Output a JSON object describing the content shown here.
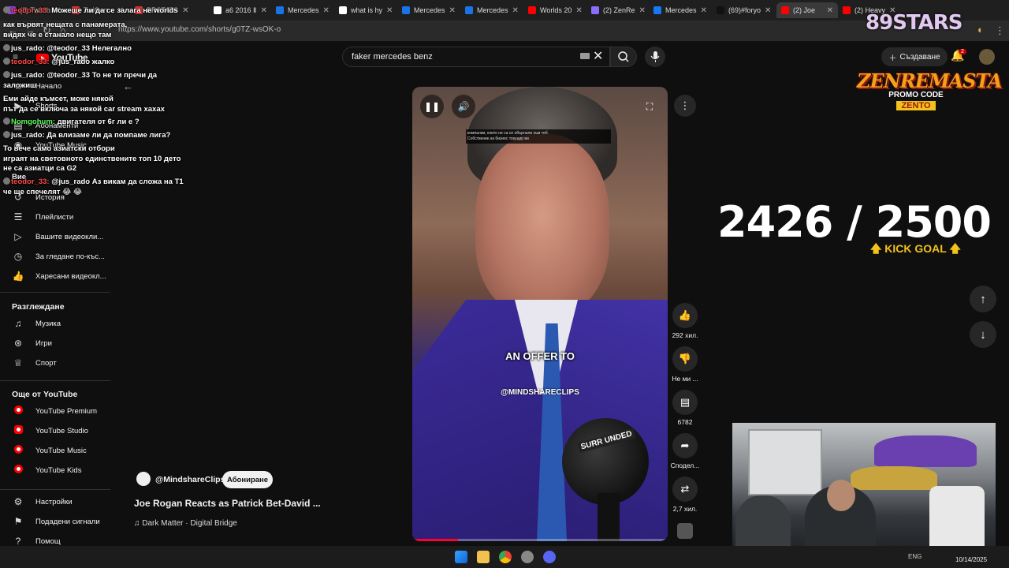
{
  "browser": {
    "url": "https://www.youtube.com/shorts/g0TZ-wsOK-o",
    "tabs": [
      {
        "label": "(2) Twitch",
        "color": "#9147ff"
      },
      {
        "label": "TwiGen",
        "color": "#e3342f"
      },
      {
        "label": "BRSTATS",
        "color": "#e3342f"
      },
      {
        "label": "a6 2016 Ⅱ",
        "color": "#ffffff"
      },
      {
        "label": "Mercedes",
        "color": "#1a73e8"
      },
      {
        "label": "what is hy",
        "color": "#ffffff"
      },
      {
        "label": "Mercedes",
        "color": "#1a73e8"
      },
      {
        "label": "Mercedes",
        "color": "#1a73e8"
      },
      {
        "label": "Worlds 20",
        "color": "#ff0000"
      },
      {
        "label": "(2) ZenRe",
        "color": "#8a6cff"
      },
      {
        "label": "Mercedes",
        "color": "#1877f2"
      },
      {
        "label": "(69)#foryo",
        "color": "#111111"
      },
      {
        "label": "(2) Joe",
        "color": "#ff0000"
      },
      {
        "label": "(2) Heavy",
        "color": "#ff0000"
      }
    ]
  },
  "masthead": {
    "search_value": "faker mercedes benz",
    "create_label": "Създаване",
    "notifications_count": "2",
    "logo_text": "YouTube"
  },
  "sidebar": {
    "top": [
      {
        "label": "Начало",
        "icon": "home-icon",
        "glyph": "⌂"
      },
      {
        "label": "Shorts",
        "icon": "shorts-icon",
        "glyph": "▶"
      },
      {
        "label": "Абонаменти",
        "icon": "subscriptions-icon",
        "glyph": "▤"
      },
      {
        "label": "YouTube Music",
        "icon": "music-icon",
        "glyph": "◉"
      }
    ],
    "you_label": "Вие",
    "you": [
      {
        "label": "История",
        "icon": "history-icon",
        "glyph": "↺"
      },
      {
        "label": "Плейлисти",
        "icon": "playlists-icon",
        "glyph": "☰"
      },
      {
        "label": "Вашите видеокли...",
        "icon": "your-videos-icon",
        "glyph": "▷"
      },
      {
        "label": "За гледане по-къс...",
        "icon": "watch-later-icon",
        "glyph": "◷"
      },
      {
        "label": "Харесани видеокл...",
        "icon": "liked-icon",
        "glyph": "👍"
      }
    ],
    "explore_title": "Разглеждане",
    "explore": [
      {
        "label": "Музика",
        "icon": "music-note-icon",
        "glyph": "♫"
      },
      {
        "label": "Игри",
        "icon": "gaming-icon",
        "glyph": "⊛"
      },
      {
        "label": "Спорт",
        "icon": "trophy-icon",
        "glyph": "♕"
      }
    ],
    "more_title": "Още от YouTube",
    "more": [
      {
        "label": "YouTube Premium",
        "icon": "youtube-premium-icon"
      },
      {
        "label": "YouTube Studio",
        "icon": "youtube-studio-icon"
      },
      {
        "label": "YouTube Music",
        "icon": "youtube-music-icon"
      },
      {
        "label": "YouTube Kids",
        "icon": "youtube-kids-icon"
      }
    ],
    "bottom": [
      {
        "label": "Настройки",
        "icon": "settings-icon",
        "glyph": "⚙"
      },
      {
        "label": "Подадени сигнали",
        "icon": "flag-icon",
        "glyph": "⚑"
      },
      {
        "label": "Помощ",
        "icon": "help-icon",
        "glyph": "?"
      }
    ]
  },
  "chat": [
    {
      "user": "teodor_33:",
      "color": "#ff4a4a",
      "text": "Можеше ли да се залага не worlds"
    },
    {
      "user": "",
      "color": "#ff4a4a",
      "text": "как вървят нещата с панамерата,"
    },
    {
      "user": "",
      "color": "#ffffff",
      "text": "видях че е станало нещо там"
    },
    {
      "user": "jus_rado:",
      "color": "#ffffff",
      "text": "@teodor_33 Нелегално"
    },
    {
      "user": "teodor_33:",
      "color": "#ff4a4a",
      "text": "@jus_rado жалко"
    },
    {
      "user": "jus_rado:",
      "color": "#ffffff",
      "text": "@teodor_33 То не ти пречи да"
    },
    {
      "user": "",
      "color": "#ffffff",
      "text": "заложиш"
    },
    {
      "user": "",
      "color": "#ff4a4a",
      "text": "Еми айде къмсет, може някой"
    },
    {
      "user": "",
      "color": "#ffffff",
      "text": "път да се включа за някой car stream хахах"
    },
    {
      "user": "Nomgohum:",
      "color": "#5aff5a",
      "text": "двигателя от 6г ли е ?"
    },
    {
      "user": "jus_rado:",
      "color": "#ffffff",
      "text": "Да влизаме ли да помпаме лига?"
    },
    {
      "user": "",
      "color": "#5aff5a",
      "text": "То вече само азиатски отбори"
    },
    {
      "user": "",
      "color": "#ffffff",
      "text": "играят на световното единствените топ 10 дето"
    },
    {
      "user": "",
      "color": "#ffffff",
      "text": "не са азиатци са G2"
    },
    {
      "user": "teodor_33:",
      "color": "#ff4a4a",
      "text": "@jus_rado Аз викам да сложа на T1"
    },
    {
      "user": "",
      "color": "#ffffff",
      "text": "че ще спечелят 😂 😂"
    }
  ],
  "short": {
    "channel": "@MindshareClips",
    "subscribe_label": "Абониране",
    "title": "Joe Rogan Reacts as Patrick Bet-David ...",
    "music": "♫ Dark Matter · Digital Bridge",
    "subtitle": "AN OFFER TO",
    "watermark": "@MINDSHARECLIPS",
    "caption_line1": "компании, които не са се обърнали към теб.",
    "caption_line2": "Собственик на бизнес токуцир ви",
    "mic_tag": "SURR UNDED",
    "progress": 0.18
  },
  "actions": [
    {
      "name": "like",
      "icon": "thumbs-up-icon",
      "glyph": "👍",
      "label": "292 хил."
    },
    {
      "name": "dislike",
      "icon": "thumbs-down-icon",
      "glyph": "👎",
      "label": "Не ми ..."
    },
    {
      "name": "comments",
      "icon": "comment-icon",
      "glyph": "▤",
      "label": "6782"
    },
    {
      "name": "share",
      "icon": "share-icon",
      "glyph": "➦",
      "label": "Сподел..."
    },
    {
      "name": "remix",
      "icon": "remix-icon",
      "glyph": "⇄",
      "label": "2,7 хил."
    }
  ],
  "overlays": {
    "stars_number": "89",
    "stars_label": "STARS",
    "sponsor_name": "ZENREMASTA",
    "promo_label": "PROMO CODE",
    "promo_code": "ZENTO",
    "goal_text": "2426 / 2500",
    "goal_label": "🡅 KICK GOAL 🡅"
  },
  "taskbar": {
    "lang": "ENG",
    "date": "10/14/2025"
  }
}
